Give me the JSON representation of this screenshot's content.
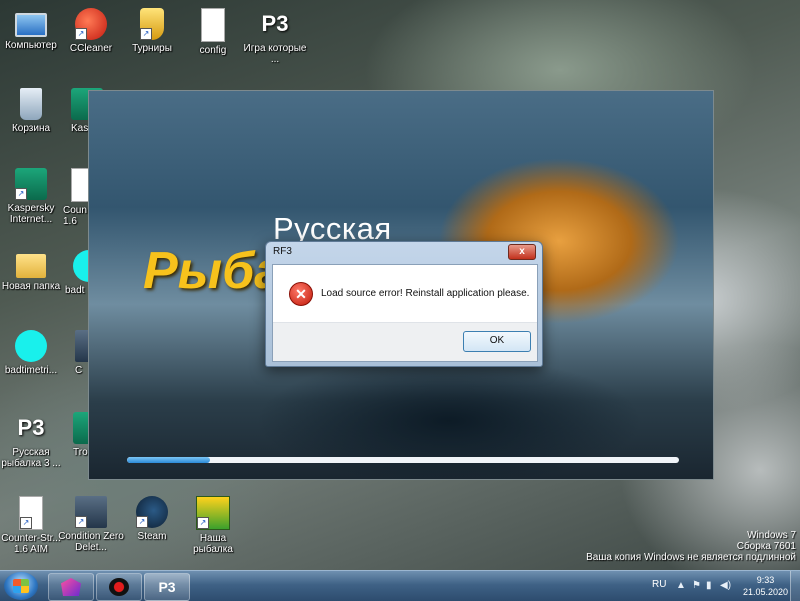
{
  "desktop": {
    "icons": [
      {
        "label": "Компьютер",
        "icon": "computer-icon"
      },
      {
        "label": "CCleaner",
        "icon": "ccleaner-icon"
      },
      {
        "label": "Турниры",
        "icon": "trophy-icon"
      },
      {
        "label": "config",
        "icon": "file-icon"
      },
      {
        "label": "Игра которые ...",
        "icon": "p3-icon",
        "glyph": "P3"
      },
      {
        "label": "Корзина",
        "icon": "recycle-bin-icon"
      },
      {
        "label": "Kaspersky Internet...",
        "icon": "kaspersky-icon"
      },
      {
        "label": "Новая папка",
        "icon": "folder-icon"
      },
      {
        "label": "badtimetri...",
        "icon": "cyan-circle-icon"
      },
      {
        "label": "Русская рыбалка 3 ...",
        "icon": "p3-icon",
        "glyph": "P3"
      },
      {
        "label": "Counter-Str... 1.6 AIM",
        "icon": "file-icon"
      },
      {
        "label": "Condition Zero Delet...",
        "icon": "counter-strike-icon"
      },
      {
        "label": "Steam",
        "icon": "steam-icon"
      },
      {
        "label": "Наша рыбалка",
        "icon": "fishing-game-icon"
      }
    ],
    "partial_icons": [
      {
        "label": "Kas Pas",
        "icon": "kaspersky-icon"
      },
      {
        "label": "Coun 1.6",
        "icon": "file-icon"
      },
      {
        "label": "badt",
        "icon": "cyan-circle-icon"
      },
      {
        "label": "C",
        "icon": "counter-strike-icon"
      },
      {
        "label": "Tro Fis",
        "icon": "kaspersky-icon"
      }
    ]
  },
  "launcher": {
    "splash_line1": "Русская",
    "splash_line2": "Рыба",
    "progress": 0.15
  },
  "dialog": {
    "title": "RF3",
    "message": "Load source error! Reinstall application please.",
    "ok_label": "OK",
    "close_glyph": "x",
    "error_glyph": "✕"
  },
  "watermark": {
    "line1": "Windows 7",
    "line2": "Сборка 7601",
    "line3": "Ваша копия Windows не является подлинной"
  },
  "taskbar": {
    "apps": [
      {
        "name": "crystal-app",
        "icon": "crystal-icon"
      },
      {
        "name": "record-app",
        "icon": "record-icon"
      },
      {
        "name": "rf3-app",
        "icon": "p3-icon",
        "glyph": "P3"
      }
    ],
    "tray": {
      "language": "RU",
      "time": "9:33",
      "date": "21.05.2020"
    }
  }
}
